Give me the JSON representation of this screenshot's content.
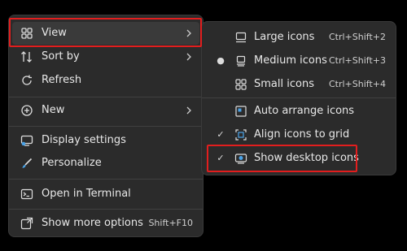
{
  "main_menu": {
    "items": [
      {
        "label": "View",
        "icon": "grid-icon",
        "submenu": true
      },
      {
        "label": "Sort by",
        "icon": "sort-icon",
        "submenu": true
      },
      {
        "label": "Refresh",
        "icon": "refresh-icon"
      },
      {
        "label": "New",
        "icon": "new-icon",
        "submenu": true
      },
      {
        "label": "Display settings",
        "icon": "display-icon"
      },
      {
        "label": "Personalize",
        "icon": "brush-icon"
      },
      {
        "label": "Open in Terminal",
        "icon": "terminal-icon"
      },
      {
        "label": "Show more options",
        "icon": "more-options-icon",
        "shortcut": "Shift+F10"
      }
    ]
  },
  "view_submenu": {
    "items": [
      {
        "label": "Large icons",
        "icon": "large-icons-icon",
        "shortcut": "Ctrl+Shift+2"
      },
      {
        "label": "Medium icons",
        "icon": "medium-icons-icon",
        "shortcut": "Ctrl+Shift+3",
        "selected": true
      },
      {
        "label": "Small icons",
        "icon": "small-icons-icon",
        "shortcut": "Ctrl+Shift+4"
      },
      {
        "label": "Auto arrange icons",
        "icon": "auto-arrange-icon"
      },
      {
        "label": "Align icons to grid",
        "icon": "align-grid-icon",
        "checked": true
      },
      {
        "label": "Show desktop icons",
        "icon": "show-desktop-icon",
        "checked": true
      }
    ]
  },
  "colors": {
    "menu_bg": "#2b2b2b",
    "highlight": "#3a3a3a",
    "annotation": "#e21e1e",
    "page_bg": "#000000"
  }
}
